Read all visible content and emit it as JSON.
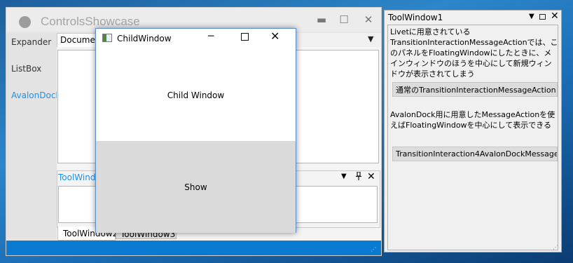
{
  "main_window": {
    "title": "ControlsShowcase",
    "min_glyph": "▬",
    "max_glyph": "☐",
    "close_glyph": "✕",
    "nav_items": [
      "Expander",
      "ListBox",
      "AvalonDock"
    ],
    "selected_nav": "AvalonDock",
    "document_tab": "Document",
    "doc_menu_glyph": "▼",
    "tool_panel": {
      "title": "ToolWindow",
      "dropdown_glyph": "▼",
      "pin_glyph": "📌",
      "close_glyph": "✕"
    },
    "tool_tabs": [
      "ToolWindow2",
      "ToolWindow3"
    ],
    "grip_glyph": "⋰"
  },
  "child_window": {
    "title": "ChildWindow",
    "min_glyph": "─",
    "close_glyph": "✕",
    "label": "Child Window",
    "show_button": "Show"
  },
  "tool_window1": {
    "title": "ToolWindow1",
    "dropdown_glyph": "▼",
    "close_glyph": "✕",
    "description_1": "Livetに用意されているTransitionInteractionMessageActionでは、このパネルをFloatingWindowにしたときに、メインウィンドウのほうを中心にして新規ウィンドウが表示されてしまう",
    "button_1": "通常のTransitionInteractionMessageAction",
    "description_2": "AvalonDock用に用意したMessageActionを使えばFloatingWindowを中心にして表示できる",
    "button_2": "TransitionInteraction4AvalonDockMessage",
    "grip_glyph": "⋰"
  },
  "colors": {
    "accent": "#1E90E6",
    "status_bar": "#0B7AD1",
    "desktop": "#1B6DB5"
  }
}
